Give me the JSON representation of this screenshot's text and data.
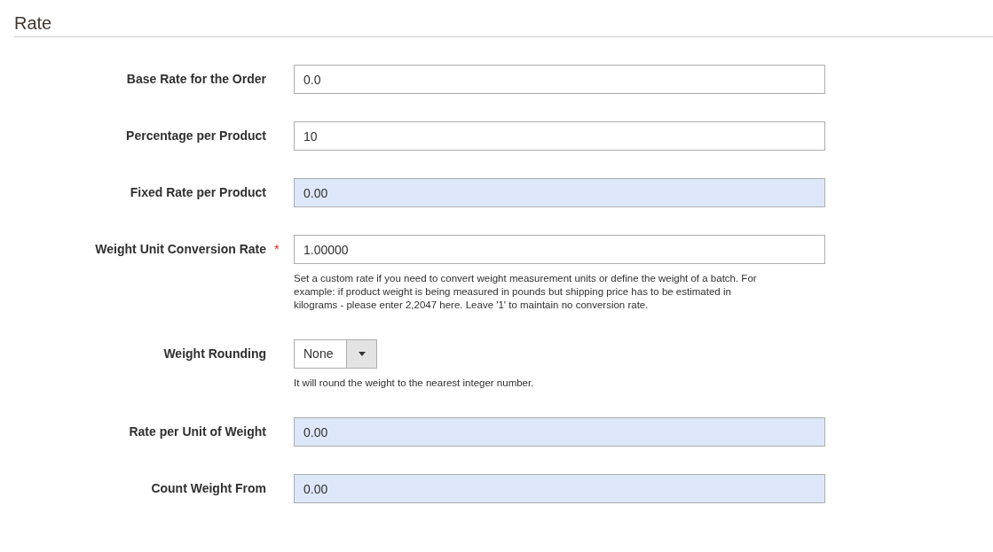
{
  "section": {
    "title": "Rate"
  },
  "fields": [
    {
      "kind": "text",
      "label": "Base Rate for the Order",
      "value": "0.0",
      "highlighted": false
    },
    {
      "kind": "text",
      "label": "Percentage per Product",
      "value": "10",
      "highlighted": false
    },
    {
      "kind": "text",
      "label": "Fixed Rate per Product",
      "value": "0.00",
      "highlighted": true
    },
    {
      "kind": "text",
      "label": "Weight Unit Conversion Rate",
      "required_marker": "*",
      "value": "1.00000",
      "highlighted": false,
      "note": "Set a custom rate if you need to convert weight measurement units or define the weight of a batch. For example: if product weight is being measured in pounds but shipping price has to be estimated in kilograms - please enter 2,2047 here. Leave '1' to maintain no conversion rate."
    },
    {
      "kind": "select",
      "label": "Weight Rounding",
      "value": "None",
      "highlighted": false,
      "note": "It will round the weight to the nearest integer number."
    },
    {
      "kind": "text",
      "label": "Rate per Unit of Weight",
      "value": "0.00",
      "highlighted": true
    },
    {
      "kind": "text",
      "label": "Count Weight From",
      "value": "0.00",
      "highlighted": true
    }
  ]
}
